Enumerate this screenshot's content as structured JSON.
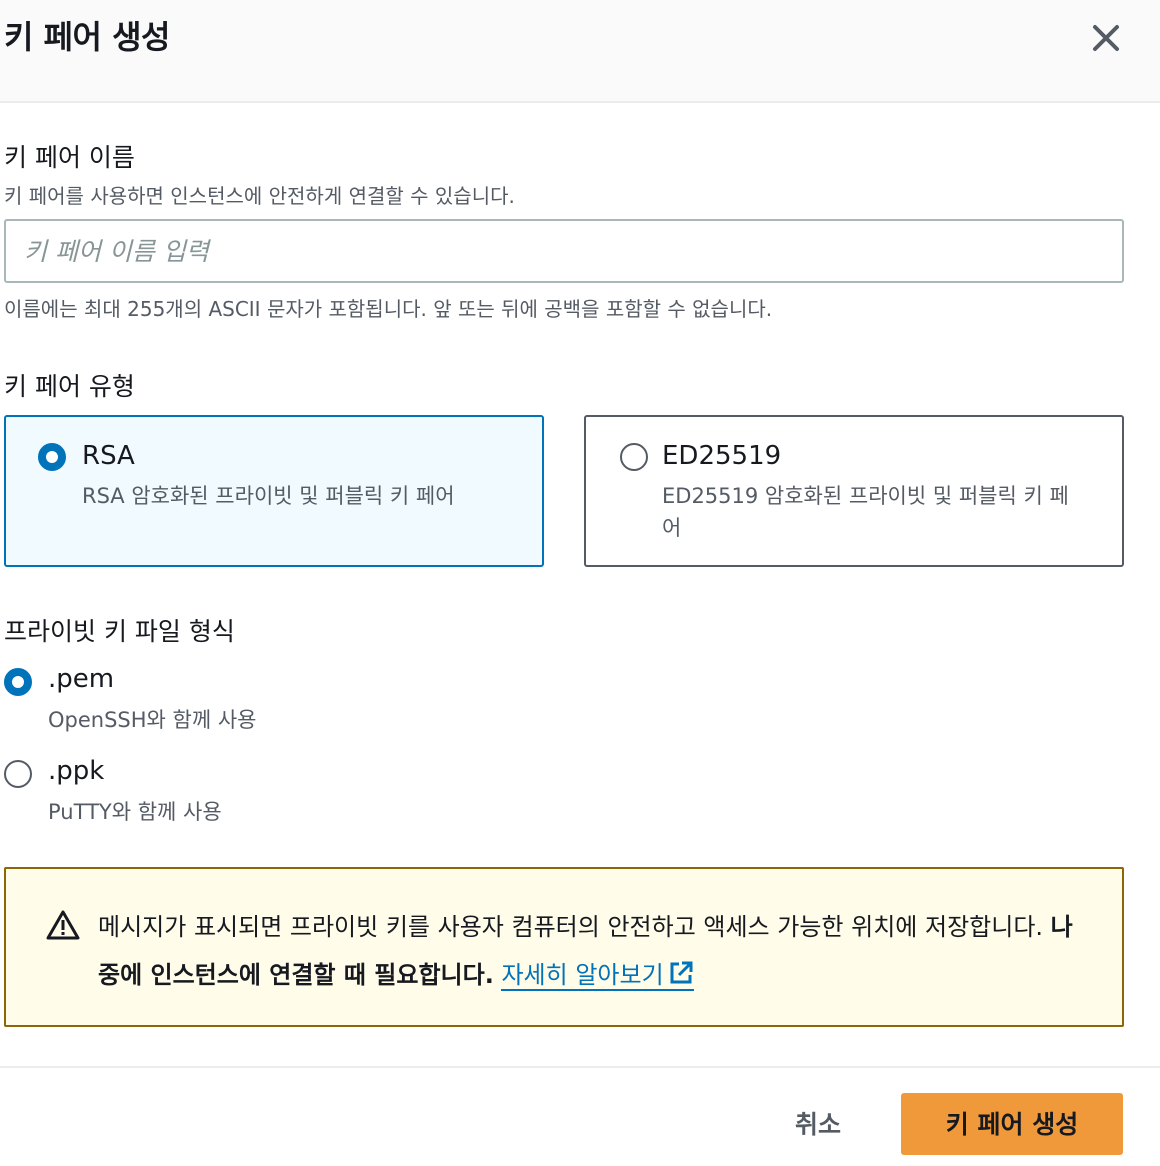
{
  "header": {
    "title": "키 페어 생성"
  },
  "key_name": {
    "label": "키 페어 이름",
    "description": "키 페어를 사용하면 인스턴스에 안전하게 연결할 수 있습니다.",
    "placeholder": "키 페어 이름 입력",
    "value": "",
    "constraint": "이름에는 최대 255개의 ASCII 문자가 포함됩니다. 앞 또는 뒤에 공백을 포함할 수 없습니다."
  },
  "key_type": {
    "label": "키 페어 유형",
    "options": [
      {
        "title": "RSA",
        "description": "RSA 암호화된 프라이빗 및 퍼블릭 키 페어",
        "selected": true
      },
      {
        "title": "ED25519",
        "description": "ED25519 암호화된 프라이빗 및 퍼블릭 키 페어",
        "selected": false
      }
    ]
  },
  "file_format": {
    "label": "프라이빗 키 파일 형식",
    "options": [
      {
        "title": ".pem",
        "description": "OpenSSH와 함께 사용",
        "selected": true
      },
      {
        "title": ".ppk",
        "description": "PuTTY와 함께 사용",
        "selected": false
      }
    ]
  },
  "alert": {
    "text": "메시지가 표시되면 프라이빗 키를 사용자 컴퓨터의 안전하고 액세스 가능한 위치에 저장합니다. ",
    "bold": "나중에 인스턴스에 연결할 때 필요합니다.",
    "link": "자세히 알아보기",
    "icon": "warning-icon"
  },
  "footer": {
    "cancel": "취소",
    "create": "키 페어 생성"
  },
  "colors": {
    "accent": "#0073bb",
    "primary_button": "#f0993a",
    "alert_border": "#8d6605",
    "alert_background": "#fffce9"
  }
}
